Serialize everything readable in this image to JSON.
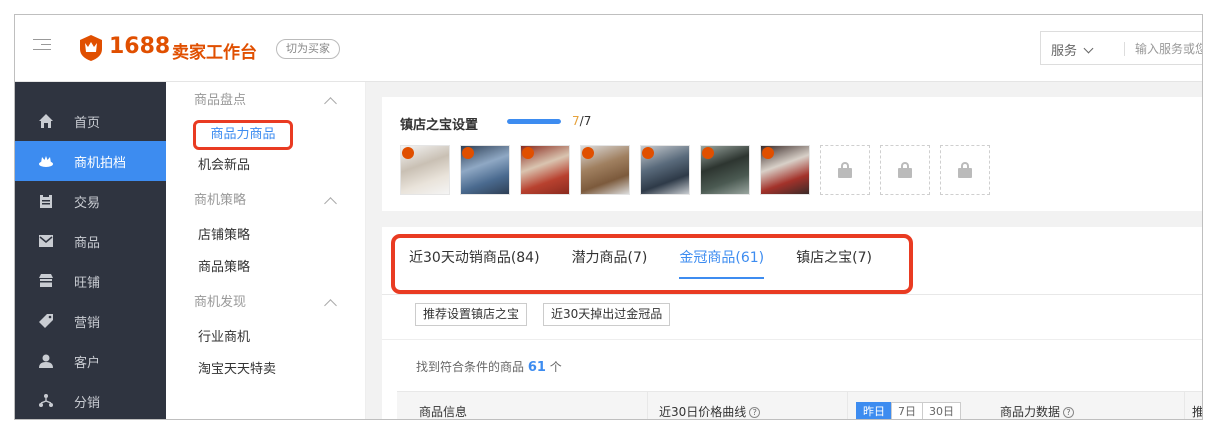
{
  "header": {
    "logo_number": "1688",
    "logo_title": "卖家工作台",
    "switch_label": "切为买家",
    "search": {
      "category": "服务",
      "placeholder": "输入服务或您"
    }
  },
  "nav": {
    "items": [
      {
        "label": "首页",
        "icon": "home-icon",
        "active": false
      },
      {
        "label": "商机拍档",
        "icon": "crown-icon",
        "active": true
      },
      {
        "label": "交易",
        "icon": "clipboard-icon",
        "active": false
      },
      {
        "label": "商品",
        "icon": "mail-icon",
        "active": false
      },
      {
        "label": "旺铺",
        "icon": "shop-icon",
        "active": false
      },
      {
        "label": "营销",
        "icon": "tag-icon",
        "active": false
      },
      {
        "label": "客户",
        "icon": "user-icon",
        "active": false
      },
      {
        "label": "分销",
        "icon": "distribute-icon",
        "active": false
      }
    ]
  },
  "subnav": {
    "groups": [
      {
        "title": "商品盘点",
        "items": [
          "商品力商品",
          "机会新品"
        ]
      },
      {
        "title": "商机策略",
        "items": [
          "店铺策略",
          "商品策略"
        ]
      },
      {
        "title": "商机发现",
        "items": [
          "行业商机",
          "淘宝天天特卖"
        ]
      }
    ]
  },
  "treasure": {
    "title": "镇店之宝设置",
    "progress_current": "7",
    "progress_total": "7",
    "progress_fraction": 1.0,
    "thumb_count": 7,
    "locked_count": 3
  },
  "tabs": [
    {
      "label": "近30天动销商品(84)",
      "active": false
    },
    {
      "label": "潜力商品(7)",
      "active": false
    },
    {
      "label": "金冠商品(61)",
      "active": true
    },
    {
      "label": "镇店之宝(7)",
      "active": false
    }
  ],
  "filters": [
    "推荐设置镇店之宝",
    "近30天掉出过金冠品"
  ],
  "result": {
    "prefix": "找到符合条件的商品",
    "count": "61",
    "suffix": "个"
  },
  "table": {
    "headers": [
      "商品信息",
      "近30日价格曲线",
      "商品力数据",
      "推"
    ],
    "help_glyph": "?",
    "range_options": [
      "昨日",
      "7日",
      "30日"
    ],
    "range_selected": "昨日"
  },
  "colors": {
    "accent": "#3d8cf0",
    "brand": "#e04f00",
    "highlight_box": "#e93b22",
    "nav_bg": "#2f3440"
  }
}
